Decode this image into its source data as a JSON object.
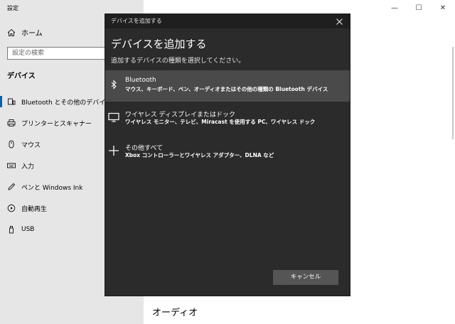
{
  "window": {
    "title": "設定",
    "controls": {
      "minimize": "—",
      "maximize": "☐",
      "close": "✕"
    }
  },
  "sidebar": {
    "home_label": "ホーム",
    "search_placeholder": "設定の検索",
    "section_title": "デバイス",
    "items": [
      {
        "label": "Bluetooth とその他のデバイス",
        "icon": "bluetooth-devices-icon",
        "selected": true
      },
      {
        "label": "プリンターとスキャナー",
        "icon": "printer-icon"
      },
      {
        "label": "マウス",
        "icon": "mouse-icon"
      },
      {
        "label": "入力",
        "icon": "keyboard-icon"
      },
      {
        "label": "ペンと Windows Ink",
        "icon": "pen-icon"
      },
      {
        "label": "自動再生",
        "icon": "autoplay-icon"
      },
      {
        "label": "USB",
        "icon": "usb-icon"
      }
    ]
  },
  "main": {
    "audio_heading": "オーディオ"
  },
  "dialog": {
    "window_title": "デバイスを追加する",
    "heading": "デバイスを追加する",
    "subtitle": "追加するデバイスの種類を選択してください。",
    "options": [
      {
        "title": "Bluetooth",
        "desc": "マウス、キーボード、ペン、オーディオまたはその他の種類の Bluetooth デバイス",
        "icon": "bluetooth-icon"
      },
      {
        "title": "ワイヤレス ディスプレイまたはドック",
        "desc": "ワイヤレス モニター、テレビ、Miracast を使用する PC、ワイヤレス ドック",
        "icon": "monitor-icon"
      },
      {
        "title": "その他すべて",
        "desc": "Xbox コントローラーとワイヤレス アダプター、DLNA など",
        "icon": "plus-icon"
      }
    ],
    "cancel_label": "キャンセル"
  },
  "colors": {
    "accent": "#0063b1",
    "dialog_bg": "#2b2b2b",
    "dialog_title_bg": "#1f1f1f",
    "highlight": "#4a4a4a",
    "button_bg": "#555555",
    "sidebar_bg": "#e6e6e6"
  }
}
